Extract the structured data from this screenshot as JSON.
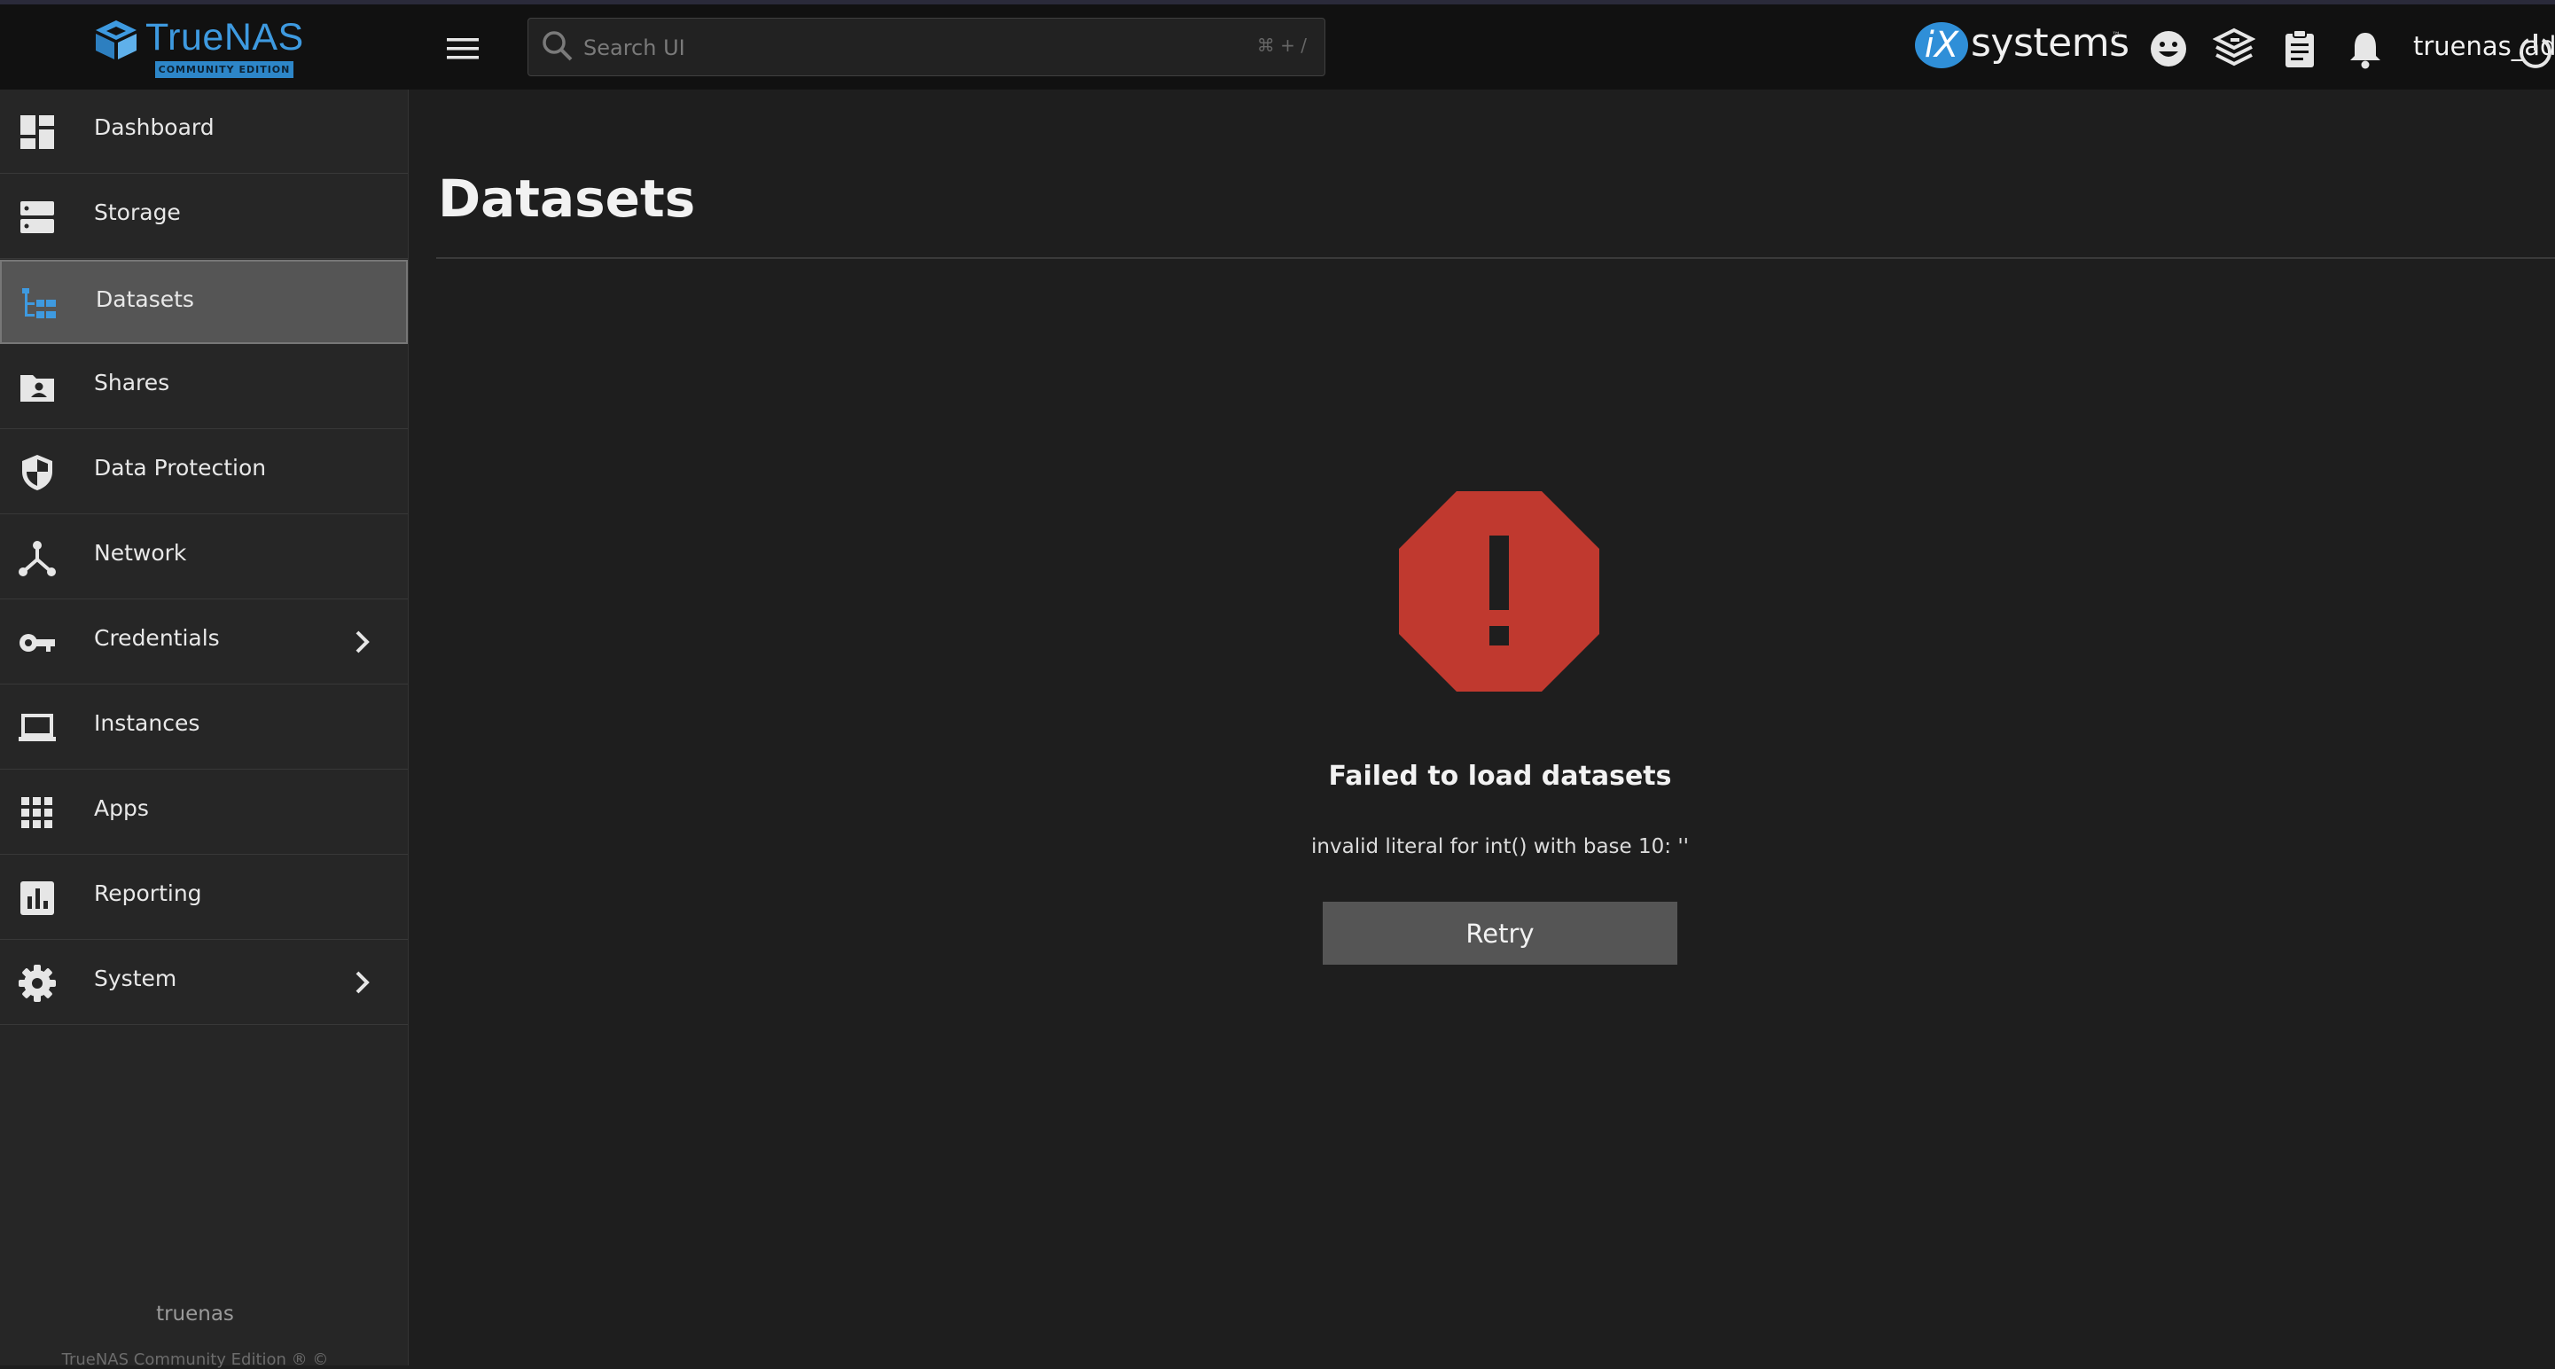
{
  "app": {
    "brand_name": "TrueNAS",
    "brand_edition": "COMMUNITY EDITION"
  },
  "topbar": {
    "search_placeholder": "Search UI",
    "search_shortcut": "⌘ + /",
    "partner_logo_mark": "iX",
    "partner_logo_text": "systems",
    "partner_logo_tm": "™",
    "username": "truenas_admin",
    "icons": [
      "menu-icon",
      "search-icon",
      "feedback-icon",
      "truecommand-icon",
      "jobs-clipboard-icon",
      "notifications-bell-icon",
      "power-icon"
    ]
  },
  "sidebar": {
    "items": [
      {
        "label": "Dashboard",
        "icon": "dashboard-icon"
      },
      {
        "label": "Storage",
        "icon": "storage-icon"
      },
      {
        "label": "Datasets",
        "icon": "datasets-icon",
        "active": true
      },
      {
        "label": "Shares",
        "icon": "shares-folder-icon"
      },
      {
        "label": "Data Protection",
        "icon": "shield-icon"
      },
      {
        "label": "Network",
        "icon": "network-icon"
      },
      {
        "label": "Credentials",
        "icon": "key-icon",
        "has_submenu": true
      },
      {
        "label": "Instances",
        "icon": "laptop-icon"
      },
      {
        "label": "Apps",
        "icon": "apps-grid-icon"
      },
      {
        "label": "Reporting",
        "icon": "reporting-chart-icon"
      },
      {
        "label": "System",
        "icon": "gear-icon",
        "has_submenu": true
      }
    ],
    "hostname": "truenas",
    "copyright": "TrueNAS Community Edition ® ©"
  },
  "main": {
    "page_title": "Datasets",
    "error": {
      "icon": "error-octagon-icon",
      "title": "Failed to load datasets",
      "message": "invalid literal for int() with base 10: ''",
      "retry_label": "Retry"
    }
  },
  "colors": {
    "accent": "#3e9ae0",
    "error": "#c0392f",
    "background": "#1e1e1e",
    "sidebar": "#262626",
    "topbar": "#111111",
    "active_item": "#555555"
  }
}
